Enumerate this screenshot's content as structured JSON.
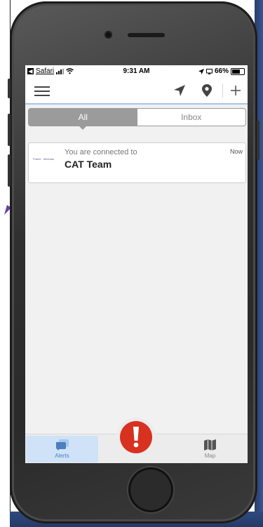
{
  "status_bar": {
    "back_glyph": "◀",
    "app_back_label": "Safari",
    "time": "9:31 AM",
    "battery": "66%",
    "battery_level": 0.66
  },
  "nav_bar": {
    "menu_icon": "hamburger-menu-icon",
    "location_icon": "location-arrow-icon",
    "pin_icon": "map-pin-icon",
    "add_label": "+"
  },
  "segmented_control": {
    "tabs": [
      {
        "label": "All",
        "selected": true
      },
      {
        "label": "Inbox",
        "selected": false
      }
    ]
  },
  "alerts": [
    {
      "subtitle": "You are connected to",
      "title": "CAT Team",
      "time": "Now",
      "logo_text": "Prairie ∙ Minerals"
    }
  ],
  "tab_bar": {
    "alerts_label": "Alerts",
    "map_label": "Map",
    "sos_symbol": "!"
  },
  "colors": {
    "accent": "#4a7fc0",
    "nav_underline": "#a8c6e6",
    "sos_red": "#d9311f",
    "segment_active": "#9b9b9b"
  }
}
